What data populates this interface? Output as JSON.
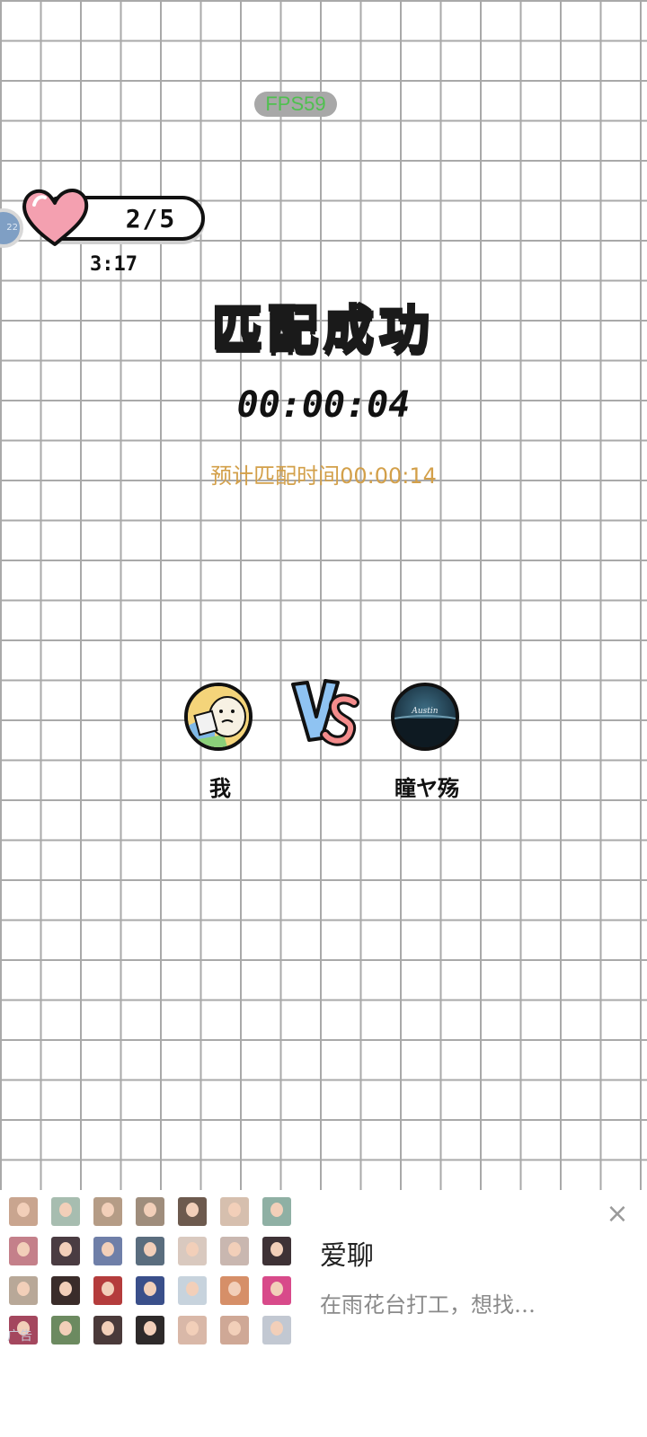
{
  "hud": {
    "fps": "FPS59",
    "edge_avatar_badge": "22"
  },
  "lives": {
    "count": "2/5",
    "refill_timer": "3:17"
  },
  "match": {
    "title": "匹配成功",
    "elapsed": "00:00:04",
    "estimate": "预计匹配时间00:00:14",
    "vs_label": "VS"
  },
  "players": {
    "me": {
      "name": "我",
      "avatar": "cartoon-bear-avatar"
    },
    "opponent": {
      "name": "瞳ヤ殇",
      "avatar": "seaside-scene-avatar"
    }
  },
  "ad": {
    "title": "爱聊",
    "description": "在雨花台打工，想找…",
    "close_icon": "close-icon",
    "watermark": "广告",
    "thumbnail_rows": 4,
    "thumbnail_cols": 7
  },
  "colors": {
    "title_fill": "#8fc3f2",
    "estimate_text": "#d3a04a",
    "fps_text": "#4fc04f",
    "heart": "#f4a0b0"
  }
}
